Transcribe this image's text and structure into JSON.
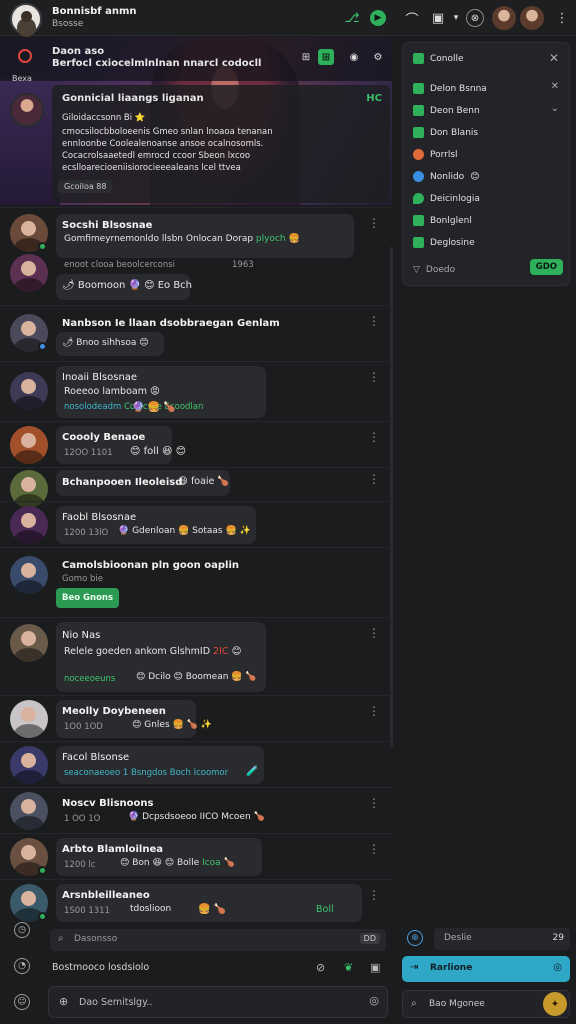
{
  "topbar": {
    "title": "Bonnisbf anmn",
    "subtitle": "Bsosse"
  },
  "banner": {
    "label": "Bexa",
    "title": "Daon aso",
    "subtitle": "Berfocl cxiocelmlnlnan nnarcl codocll",
    "card": {
      "title": "Gonnicial liaangs liganan",
      "right_tag": "HC",
      "lines": [
        "Giloidaccsonn Bi ⭐",
        "cmocsilocbboloeenis Gmeo snlan lnoaoa tenanan",
        "ennloonbe Coolealenoanse ansoe ocalnosomls.",
        "Cocacrolsaaetedl emrocd ccoor Sbeon lxcoo",
        "ecslloarecioeniisiorocieeealeans lcel ttvea"
      ],
      "pill": "Gcoiloa 88"
    }
  },
  "messages": [
    {
      "name": "Socshi Blsosnae",
      "text": "Gomfimeyrnemonldo llsbn Onlocan Dorap",
      "link": "plyoch",
      "sub": "enoot clooa beoolcerconsi",
      "time": "1963",
      "reactions": "🌶 Boomoon 🔮 😊 Eo Bch"
    },
    {
      "name": "Nanbson Ie llaan dsobbraegan Genlam",
      "reactions": "🌶 Bnoo sihhsoa 😊"
    },
    {
      "name": "Inoaii Blsosnae",
      "text": "Roeeoo lamboam 😡",
      "teal": "nosolodeadm",
      "green": "Conlcsce Ecoodlan",
      "reactions": "🔮 🍔 🍗"
    },
    {
      "name": "Coooly Benaoe",
      "sub": "12OO 1101",
      "reactions": "😊 foll 😆 😊"
    },
    {
      "name": "Bchanpooen Ileoleisd",
      "react_name": "foaie",
      "reactions": "😆 🍗"
    },
    {
      "name": "Faobl Blsosnae",
      "sub": "1200 13lO",
      "reactions": "🔮 Gdenloan 🍔 Sotaas 🍔 ✨"
    },
    {
      "name": "Camolsbioonan pln goon oaplin",
      "sub": "Gomo bie",
      "button": "Beo Gnons"
    },
    {
      "name": "Nio Nas",
      "text": "Relele goeden ankom GlshmID",
      "badge": "2IC",
      "green": "noceeoeuns",
      "reactions": "😊 Dcilo 😊 Boomean 🍔 🍗"
    },
    {
      "name": "Meolly Doybeneen",
      "sub": "1O0 1OD",
      "reactions": "😊 Gnles 🍔 🍗 ✨"
    },
    {
      "name": "Facol Blsonse",
      "teal": "seaconaeoeo 1 Bsngdos Boch Icoomor",
      "reactions": "🧪"
    },
    {
      "name": "Noscv Blisnoons",
      "sub": "1 OO 1O",
      "reactions": "🔮 Dcpsdsoeoo IICO Mcoen 🍗"
    },
    {
      "name": "Arbto Blamloilnea",
      "sub": "1200 lc",
      "reactions": "😊 Bon 😆 😊 Bolle",
      "green": "Icoa",
      "tail": "🍗"
    },
    {
      "name": "Arsnbleilleaneo",
      "sub": "1S00 1311",
      "text": "tdoslioon",
      "reactions": "🍔 🍗",
      "right": "Boll"
    }
  ],
  "bottom": {
    "search_placeholder": "Dasonsso",
    "search_kbd": "DD",
    "compose_hint": "Bostmooco losdsiolo",
    "compose_placeholder": "Dao Semitslgy.."
  },
  "panel": {
    "title": "Conolle",
    "items": [
      {
        "label": "Delon Bsnna",
        "icon": "check"
      },
      {
        "label": "Deon Benn",
        "icon": "check"
      },
      {
        "label": "Don Blanis",
        "icon": "check"
      },
      {
        "label": "Porrlsl",
        "icon": "fire"
      },
      {
        "label": "Nonlido",
        "icon": "globe"
      },
      {
        "label": "Deicinlogia",
        "icon": "shield"
      },
      {
        "label": "Bonlglenl",
        "icon": "check"
      },
      {
        "label": "Deglosine",
        "icon": "check"
      }
    ],
    "footer_label": "Doedo",
    "footer_button": "GDO"
  },
  "rightbottom": {
    "search_placeholder": "Deslie",
    "count": "29",
    "primary": "Rarlione",
    "input_placeholder": "Bao Mgonee"
  },
  "colors": {
    "accent_green": "#2fb05a",
    "accent_teal": "#2fa7c6",
    "background": "#1b1c1e"
  }
}
